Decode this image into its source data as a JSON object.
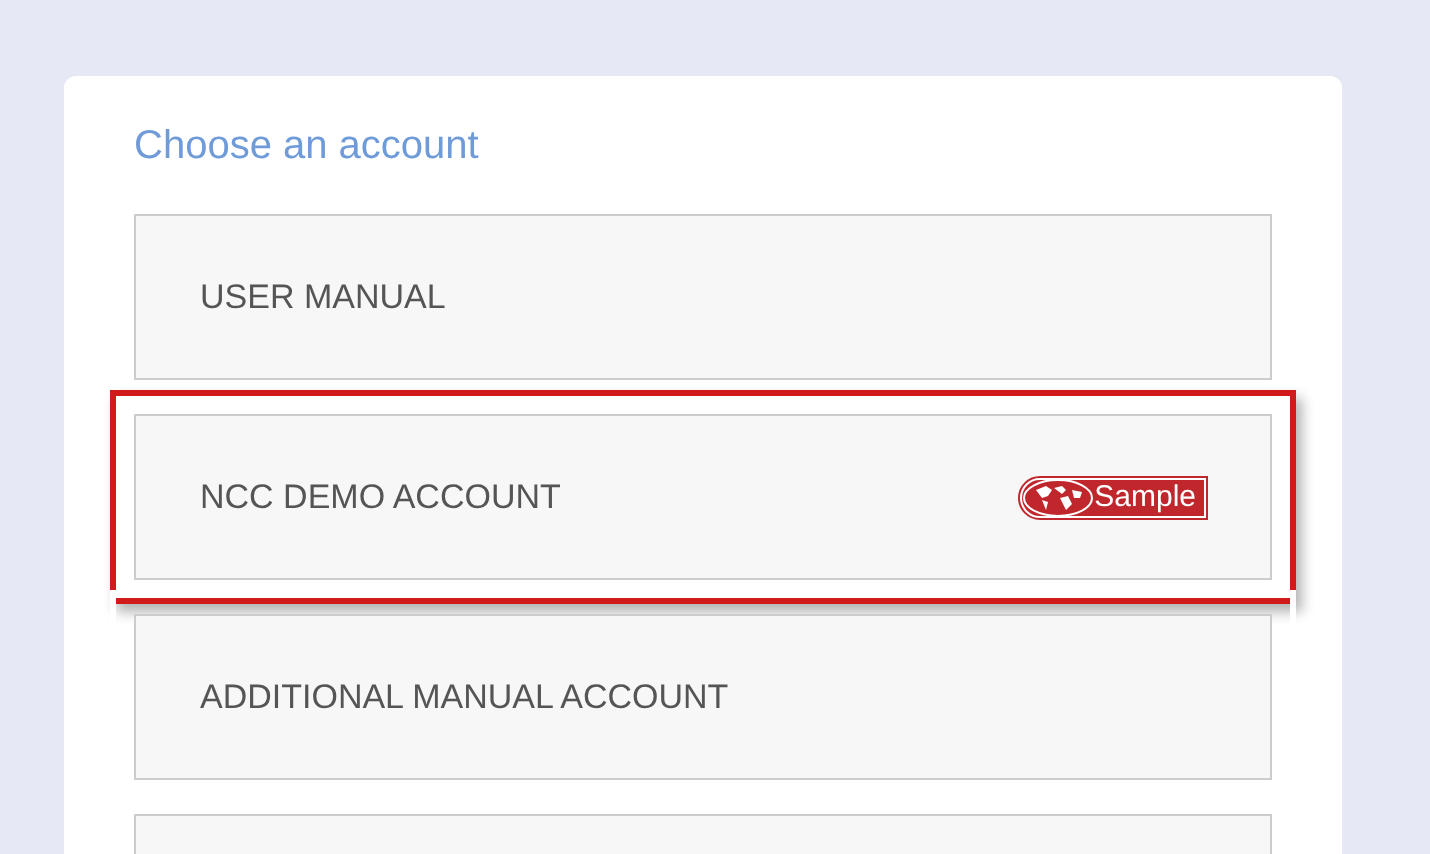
{
  "title": "Choose an account",
  "accounts": [
    {
      "label": "USER MANUAL",
      "selected": false
    },
    {
      "label": "NCC DEMO ACCOUNT",
      "selected": true,
      "badge": "Sample"
    },
    {
      "label": "ADDITIONAL MANUAL ACCOUNT",
      "selected": false
    },
    {
      "selected": false
    }
  ]
}
